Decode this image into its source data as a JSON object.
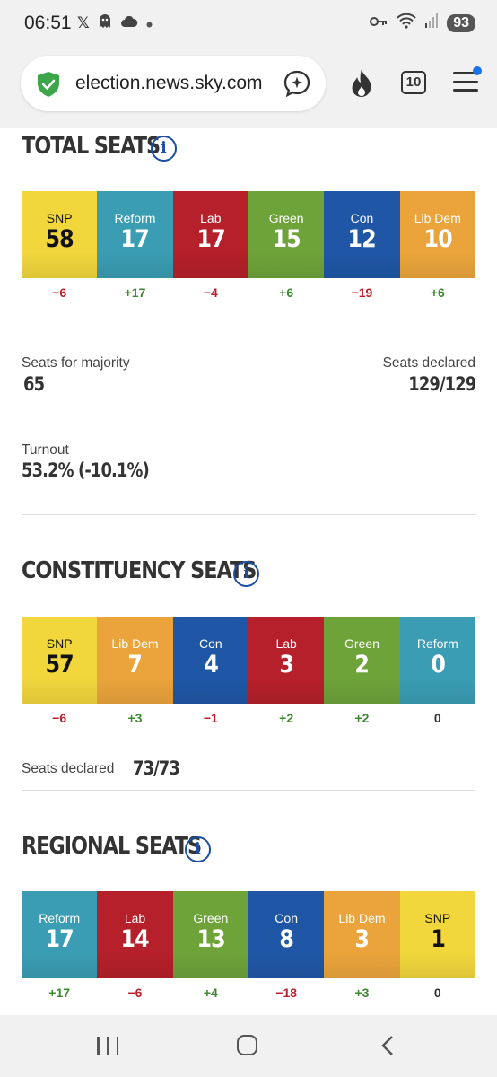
{
  "status_bar": {
    "time": "06:51",
    "battery": "93",
    "icons_left": [
      "x-logo-icon",
      "ghost-icon",
      "cloud-icon",
      "dot-icon"
    ],
    "icons_right": [
      "key-icon",
      "wifi-icon",
      "signal-icon",
      "battery-icon"
    ]
  },
  "browser": {
    "url": "election.news.sky.com",
    "tab_count": "10",
    "icons": [
      "shield-check-icon",
      "ai-assistant-icon",
      "fire-icon",
      "tabs-icon",
      "menu-icon"
    ]
  },
  "total": {
    "title": "TOTAL SEATS",
    "parties": [
      {
        "name": "SNP",
        "seats": "58",
        "change": "−6",
        "color": "#f1d63c"
      },
      {
        "name": "Reform",
        "seats": "17",
        "change": "+17",
        "color": "#3a9db3"
      },
      {
        "name": "Lab",
        "seats": "17",
        "change": "−4",
        "color": "#b5202a"
      },
      {
        "name": "Green",
        "seats": "15",
        "change": "+6",
        "color": "#6ea33a"
      },
      {
        "name": "Con",
        "seats": "12",
        "change": "−19",
        "color": "#1f57a6"
      },
      {
        "name": "Lib Dem",
        "seats": "10",
        "change": "+6",
        "color": "#eaa43b"
      }
    ],
    "majority_label": "Seats for majority",
    "majority_value": "65",
    "declared_label": "Seats declared",
    "declared_value": "129/129",
    "turnout_label": "Turnout",
    "turnout_value": "53.2% (-10.1%)"
  },
  "constituency": {
    "title": "CONSTITUENCY SEATS",
    "parties": [
      {
        "name": "SNP",
        "seats": "57",
        "change": "−6",
        "color": "#f1d63c"
      },
      {
        "name": "Lib Dem",
        "seats": "7",
        "change": "+3",
        "color": "#eaa43b"
      },
      {
        "name": "Con",
        "seats": "4",
        "change": "−1",
        "color": "#1f57a6"
      },
      {
        "name": "Lab",
        "seats": "3",
        "change": "+2",
        "color": "#b5202a"
      },
      {
        "name": "Green",
        "seats": "2",
        "change": "+2",
        "color": "#6ea33a"
      },
      {
        "name": "Reform",
        "seats": "0",
        "change": "0",
        "color": "#3a9db3"
      }
    ],
    "declared_label": "Seats declared",
    "declared_value": "73/73"
  },
  "regional": {
    "title": "REGIONAL SEATS",
    "parties": [
      {
        "name": "Reform",
        "seats": "17",
        "change": "+17",
        "color": "#3a9db3"
      },
      {
        "name": "Lab",
        "seats": "14",
        "change": "−6",
        "color": "#b5202a"
      },
      {
        "name": "Green",
        "seats": "13",
        "change": "+4",
        "color": "#6ea33a"
      },
      {
        "name": "Con",
        "seats": "8",
        "change": "−18",
        "color": "#1f57a6"
      },
      {
        "name": "Lib Dem",
        "seats": "3",
        "change": "+3",
        "color": "#eaa43b"
      },
      {
        "name": "SNP",
        "seats": "1",
        "change": "0",
        "color": "#f1d63c"
      }
    ]
  },
  "nav": {
    "icons": [
      "recent-apps-icon",
      "home-icon",
      "back-icon"
    ]
  }
}
